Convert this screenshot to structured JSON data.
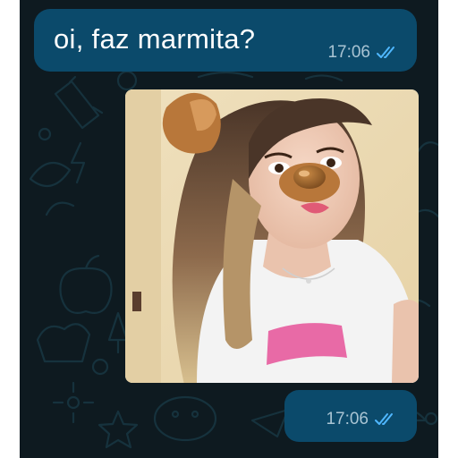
{
  "chat": {
    "background_color": "#0e1a20",
    "bubble_color": "#0b4a6b",
    "tick_color": "#4fb7ff"
  },
  "messages": [
    {
      "type": "text",
      "text": "oi, faz marmita?",
      "time": "17:06",
      "status_icon": "double-check-icon"
    },
    {
      "type": "image",
      "image_description_icon": "selfie-photo",
      "time": "17:06",
      "status_icon": "double-check-icon"
    }
  ]
}
